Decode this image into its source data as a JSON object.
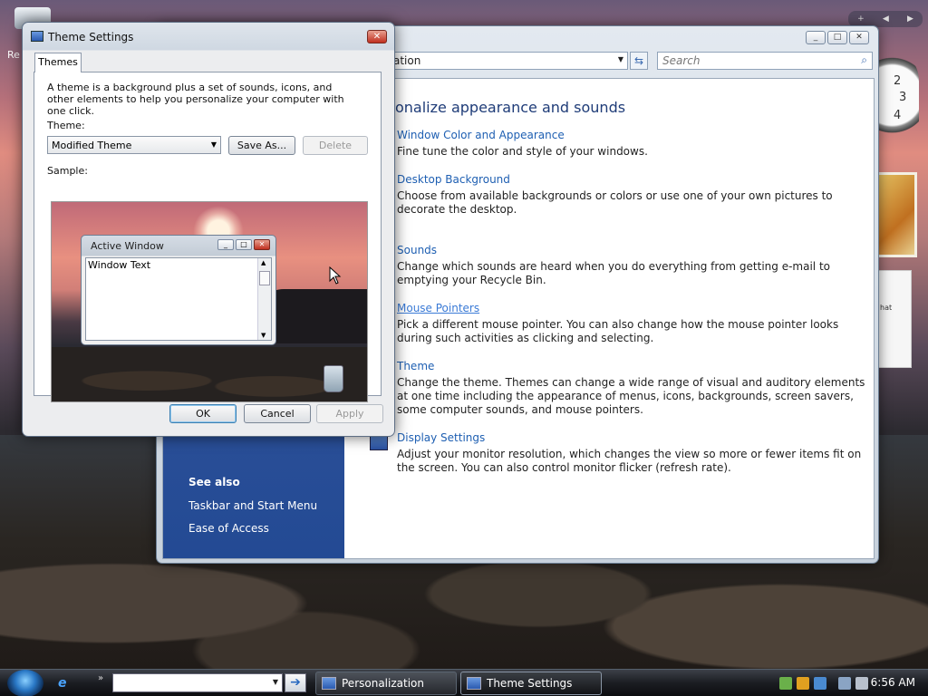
{
  "desktop": {
    "icon_label_fragment": "Re"
  },
  "gadgets": {
    "clock_numbers": [
      "2",
      "3",
      "4"
    ],
    "note_fragment": "hat"
  },
  "personalization": {
    "address_text": "ation",
    "search_placeholder": "Search",
    "heading": "onalize appearance and sounds",
    "items": [
      {
        "title": "Window Color and Appearance",
        "desc": "Fine tune the color and style of your windows."
      },
      {
        "title": "Desktop Background",
        "desc": "Choose from available backgrounds or colors or use one of your own pictures to decorate the desktop."
      },
      {
        "title": "Sounds",
        "desc": "Change which sounds are heard when you do everything from getting e-mail to emptying your Recycle Bin."
      },
      {
        "title": "Mouse Pointers",
        "desc": "Pick a different mouse pointer. You can also change how the mouse pointer looks during such activities as clicking and selecting."
      },
      {
        "title": "Theme",
        "desc": "Change the theme. Themes can change a wide range of visual and auditory elements at one time including the appearance of menus, icons, backgrounds, screen savers, some computer sounds, and mouse pointers."
      },
      {
        "title": "Display Settings",
        "desc": "Adjust your monitor resolution, which changes the view so more or fewer items fit on the screen. You can also control monitor flicker (refresh rate)."
      }
    ],
    "see_also": {
      "title": "See also",
      "links": [
        "Taskbar and Start Menu",
        "Ease of Access"
      ]
    }
  },
  "theme_dialog": {
    "title": "Theme Settings",
    "tab": "Themes",
    "intro": "A theme is a background plus a set of sounds, icons, and other elements to help you personalize your computer with one click.",
    "theme_label": "Theme:",
    "theme_value": "Modified Theme",
    "save_as": "Save As...",
    "delete": "Delete",
    "sample_label": "Sample:",
    "active_window_title": "Active Window",
    "window_text": "Window Text",
    "ok": "OK",
    "cancel": "Cancel",
    "apply": "Apply"
  },
  "taskbar": {
    "buttons": [
      {
        "label": "Personalization"
      },
      {
        "label": "Theme Settings"
      }
    ],
    "time": "6:56 AM"
  }
}
